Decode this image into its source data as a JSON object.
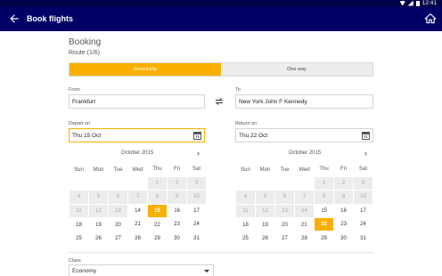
{
  "status_bar": {
    "time": "12:41"
  },
  "app_bar": {
    "title": "Book flights"
  },
  "booking": {
    "heading": "Booking",
    "route_step": "Route (1/6)",
    "tabs": [
      {
        "label": "Round trip",
        "active": true
      },
      {
        "label": "One way",
        "active": false
      }
    ],
    "from": {
      "label": "From",
      "value": "Frankfurt"
    },
    "to": {
      "label": "To",
      "value": "New York John F Kennedy"
    },
    "depart": {
      "label": "Depart on",
      "value": "Thu 15 Oct"
    },
    "return": {
      "label": "Return on",
      "value": "Thu 22 Oct"
    }
  },
  "calendars": [
    {
      "month": "October 2015",
      "weekdays": [
        "Sun",
        "Mon",
        "Tue",
        "Wed",
        "Thu",
        "Fri",
        "Sat"
      ],
      "weeks": [
        [
          "",
          "",
          "",
          "",
          "1",
          "2",
          "3"
        ],
        [
          "4",
          "5",
          "6",
          "7",
          "8",
          "9",
          "10"
        ],
        [
          "11",
          "12",
          "13",
          "14",
          "15",
          "16",
          "17"
        ],
        [
          "18",
          "19",
          "20",
          "21",
          "22",
          "23",
          "24"
        ],
        [
          "25",
          "26",
          "27",
          "28",
          "29",
          "30",
          "31"
        ]
      ],
      "selected_day": "15",
      "disabled_before": 14
    },
    {
      "month": "October 2015",
      "weekdays": [
        "Sun",
        "Mon",
        "Tue",
        "Wed",
        "Thu",
        "Fri",
        "Sat"
      ],
      "weeks": [
        [
          "",
          "",
          "",
          "",
          "1",
          "2",
          "3"
        ],
        [
          "4",
          "5",
          "6",
          "7",
          "8",
          "9",
          "10"
        ],
        [
          "11",
          "12",
          "13",
          "14",
          "15",
          "16",
          "17"
        ],
        [
          "18",
          "19",
          "20",
          "21",
          "22",
          "23",
          "24"
        ],
        [
          "25",
          "26",
          "27",
          "28",
          "29",
          "30",
          "31"
        ]
      ],
      "selected_day": "22",
      "disabled_before": 15
    }
  ],
  "travel_class": {
    "label": "Class",
    "value": "Economy"
  },
  "colors": {
    "app_bar": "#000066",
    "accent": "#f9b000"
  },
  "icons": {
    "back": "arrow-back-icon",
    "home": "home-icon",
    "swap": "swap-icon",
    "calendar": "calendar-icon",
    "next": "chevron-right-icon"
  }
}
